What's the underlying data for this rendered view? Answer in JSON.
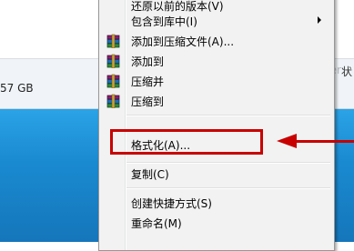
{
  "background": {
    "left_size_text": "57 GB",
    "right_ghost_text": "der",
    "right_label_text": "状"
  },
  "context_menu": {
    "items": [
      {
        "label": "还原以前的版本(V)",
        "icon": "none",
        "submenu": false
      },
      {
        "label": "包含到库中(I)",
        "icon": "none",
        "submenu": true
      },
      {
        "label": "添加到压缩文件(A)...",
        "icon": "winrar-books-icon",
        "submenu": false
      },
      {
        "label": "添加到",
        "icon": "winrar-books-icon",
        "submenu": false
      },
      {
        "label": "压缩并",
        "icon": "winrar-books-icon",
        "submenu": false
      },
      {
        "label": "压缩到",
        "icon": "winrar-books-icon",
        "submenu": false
      },
      {
        "label": "格式化(A)...",
        "icon": "none",
        "submenu": false
      },
      {
        "label": "复制(C)",
        "icon": "none",
        "submenu": false
      },
      {
        "label": "创建快捷方式(S)",
        "icon": "none",
        "submenu": false
      },
      {
        "label": "重命名(M)",
        "icon": "none",
        "submenu": false
      }
    ]
  },
  "annotation": {
    "highlight_color": "#c80000",
    "highlighted_item": "格式化(A)..."
  },
  "colors": {
    "menu_bg": "#f2f2f2",
    "desktop_blue": "#1e8fd4"
  }
}
